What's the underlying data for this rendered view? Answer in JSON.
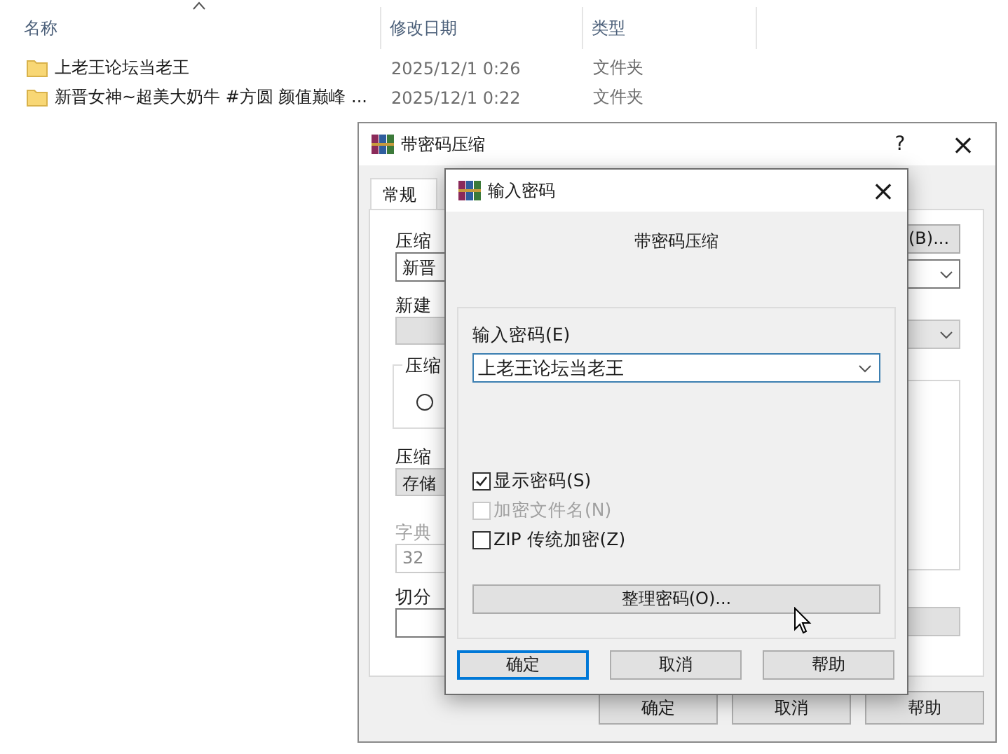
{
  "explorer": {
    "columns": [
      {
        "label": "名称",
        "sorted": true
      },
      {
        "label": "修改日期",
        "sorted": false
      },
      {
        "label": "类型",
        "sorted": false
      }
    ],
    "rows": [
      {
        "name": "上老王论坛当老王",
        "modified": "2025/12/1 0:26",
        "type": "文件夹"
      },
      {
        "name": "新晋女神~超美大奶牛 #方圆 颜值巅峰 ...",
        "modified": "2025/12/1 0:22",
        "type": "文件夹"
      }
    ]
  },
  "archive_dialog": {
    "title": "带密码压缩",
    "help": "?",
    "close": "×",
    "tabs": [
      {
        "label": "常规",
        "selected": true
      }
    ],
    "left": [
      {
        "kind": "label",
        "text": "压缩",
        "disabled": false
      },
      {
        "kind": "field",
        "value": "新晋",
        "disabled": false
      },
      {
        "kind": "label",
        "text": "新建",
        "disabled": false
      },
      {
        "kind": "dropdown",
        "disabled": true
      },
      {
        "kind": "group",
        "text": "压缩",
        "checked": false
      },
      {
        "kind": "label",
        "text": "压缩",
        "disabled": false
      },
      {
        "kind": "dropdown",
        "value": "存储",
        "disabled": true
      },
      {
        "kind": "label",
        "text": "字典",
        "disabled": true
      },
      {
        "kind": "field",
        "value": "32",
        "disabled": true
      },
      {
        "kind": "label",
        "text": "切分",
        "disabled": false
      },
      {
        "kind": "field",
        "disabled": false
      }
    ],
    "right": [
      {
        "kind": "button",
        "text": "(B)...",
        "disabled": false
      },
      {
        "kind": "dropdown",
        "disabled": false
      },
      {
        "kind": "dropdown",
        "disabled": true
      },
      {
        "kind": "listbox"
      },
      {
        "kind": "button",
        "disabled": true
      }
    ],
    "buttons": [
      "确定",
      "取消",
      "帮助"
    ]
  },
  "password_dialog": {
    "title": "输入密码",
    "close": "×",
    "heading": "带密码压缩",
    "password_label": "输入密码(E)",
    "password": "上老王论坛当老王",
    "checkboxes": [
      {
        "label": "显示密码(S)",
        "checked": true,
        "disabled": false
      },
      {
        "label": "加密文件名(N)",
        "checked": false,
        "disabled": true
      },
      {
        "label": "ZIP 传统加密(Z)",
        "checked": false,
        "disabled": false
      }
    ],
    "organize_button": "整理密码(O)...",
    "buttons": [
      {
        "label": "确定",
        "default": true
      },
      {
        "label": "取消",
        "default": false
      },
      {
        "label": "帮助",
        "default": false
      }
    ]
  }
}
